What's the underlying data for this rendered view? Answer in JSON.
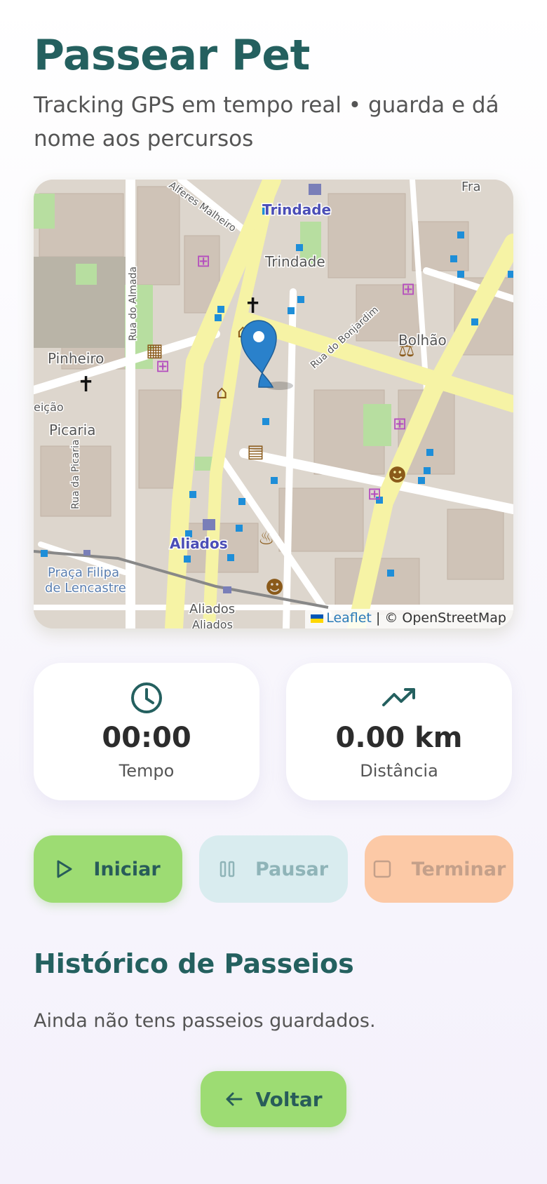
{
  "header": {
    "title": "Passear Pet",
    "subtitle": "Tracking GPS em tempo real • guarda e dá nome aos percursos"
  },
  "map": {
    "labels": {
      "trindade_station": "Trindade",
      "trindade": "Trindade",
      "alferes": "Alferes Malheiro",
      "almada": "Rua do Almada",
      "bonjardim": "Rua do Bonjardim",
      "bolhao": "Bolhão",
      "pinheiro": "Pinheiro",
      "eicao": "eição",
      "picaria": "Picaria",
      "rua_picaria": "Rua da Picaria",
      "aliados_station": "Aliados",
      "aliados": "Aliados",
      "aliados2": "Aliados",
      "praca": "Praça Filipa",
      "lencastre": "de Lencastre",
      "fra": "Fra"
    },
    "attribution": {
      "leaflet": "Leaflet",
      "osm": "| © OpenStreetMap"
    }
  },
  "stats": {
    "time": {
      "icon": "clock-icon",
      "value": "00:00",
      "label": "Tempo"
    },
    "distance": {
      "icon": "trending-up-icon",
      "value": "0.00 km",
      "label": "Distância"
    }
  },
  "controls": {
    "start_label": "Iniciar",
    "pause_label": "Pausar",
    "stop_label": "Terminar"
  },
  "history": {
    "title": "Histórico de Passeios",
    "empty_text": "Ainda não tens passeios guardados."
  },
  "back_label": "Voltar",
  "colors": {
    "primary": "#24605f",
    "start": "#9ddc73",
    "pause": "#d9ecef",
    "stop": "#fcc9a6",
    "marker": "#2a81cb"
  }
}
